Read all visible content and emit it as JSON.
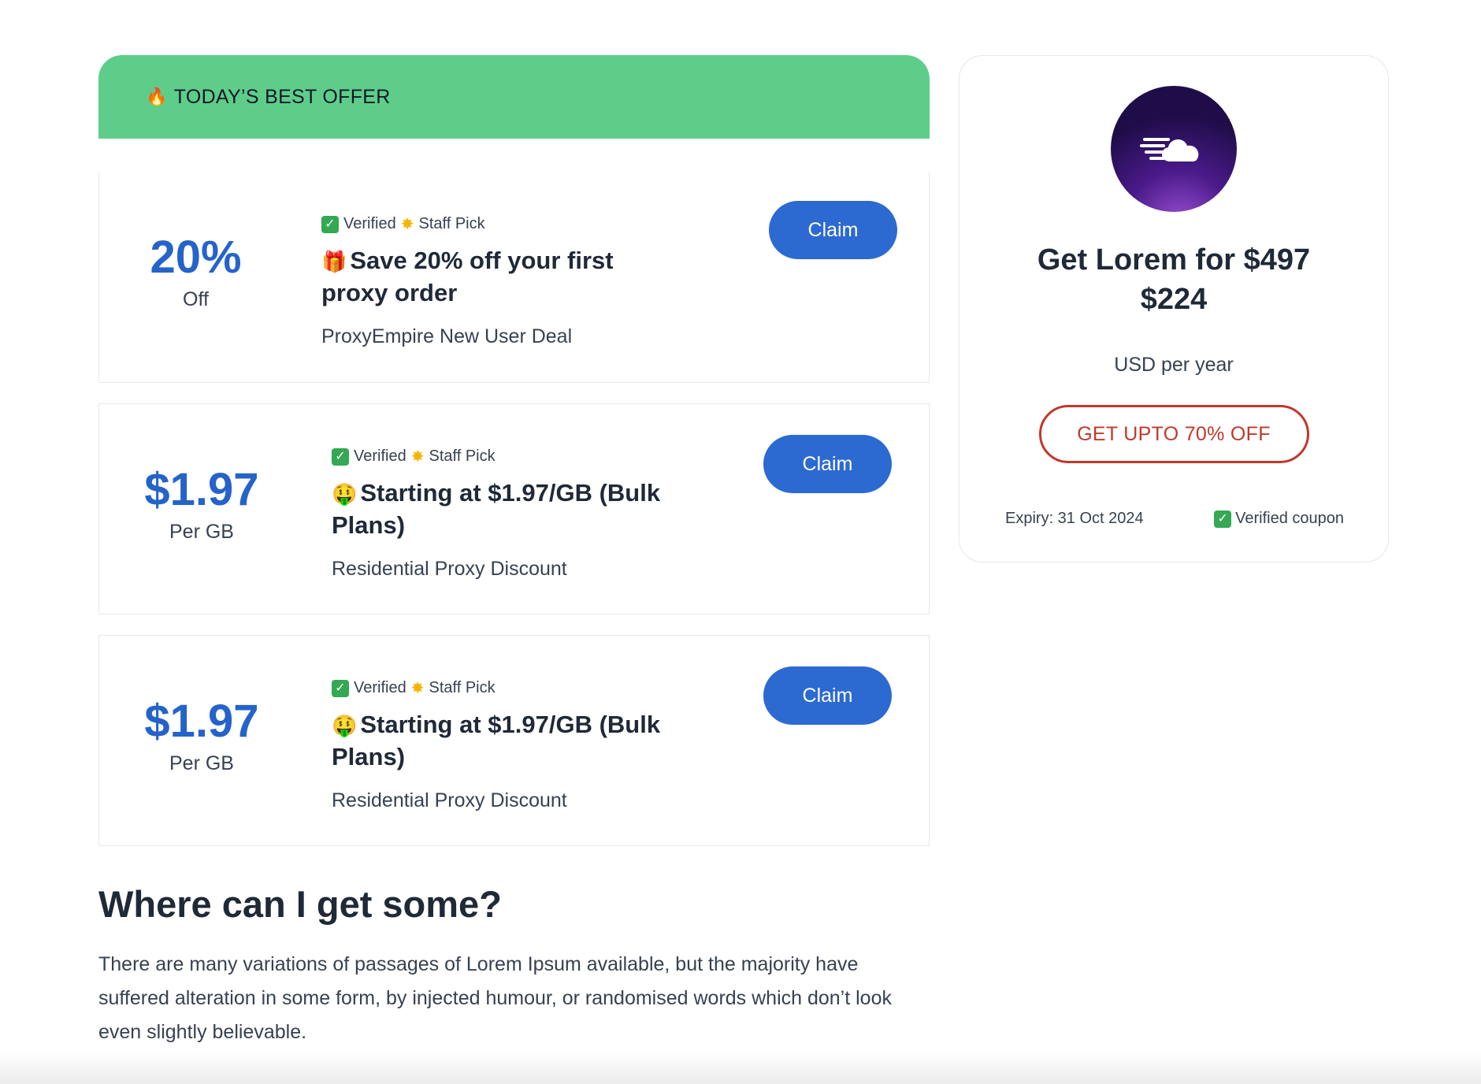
{
  "banner": {
    "icon": "fire-icon",
    "label": "TODAY’S BEST OFFER"
  },
  "offers": [
    {
      "amount": "20%",
      "unit": "Off",
      "verified": "Verified",
      "staff_pick": "Staff Pick",
      "emoji": "🎁",
      "title": "Save 20% off your first proxy order",
      "subtitle": "ProxyEmpire New User Deal",
      "claim_label": "Claim"
    },
    {
      "amount": "$1.97",
      "unit": "Per GB",
      "verified": "Verified",
      "staff_pick": "Staff Pick",
      "emoji": "🤑",
      "title": "Starting at $1.97/GB (Bulk Plans)",
      "subtitle": "Residential Proxy Discount",
      "claim_label": "Claim"
    },
    {
      "amount": "$1.97",
      "unit": "Per GB",
      "verified": "Verified",
      "staff_pick": "Staff Pick",
      "emoji": "🤑",
      "title": "Starting at $1.97/GB (Bulk Plans)",
      "subtitle": "Residential Proxy Discount",
      "claim_label": "Claim"
    }
  ],
  "article": {
    "heading": "Where can I get some?",
    "paragraph": "There are many variations of passages of Lorem Ipsum available, but the majority have suffered alteration in some form, by injected humour, or randomised words which don’t look even slightly believable."
  },
  "sidebar": {
    "logo_icon": "cloud-speed-icon",
    "title_line1": "Get Lorem for $497",
    "title_line2": "$224",
    "unit": "USD per year",
    "cta_label": "GET UPTO 70% OFF",
    "expiry": "Expiry: 31 Oct 2024",
    "verified": "Verified coupon"
  },
  "colors": {
    "banner_green": "#5ecd89",
    "accent_blue": "#2c6ad1",
    "amount_blue": "#2563c9",
    "cta_red": "#c0392b"
  }
}
